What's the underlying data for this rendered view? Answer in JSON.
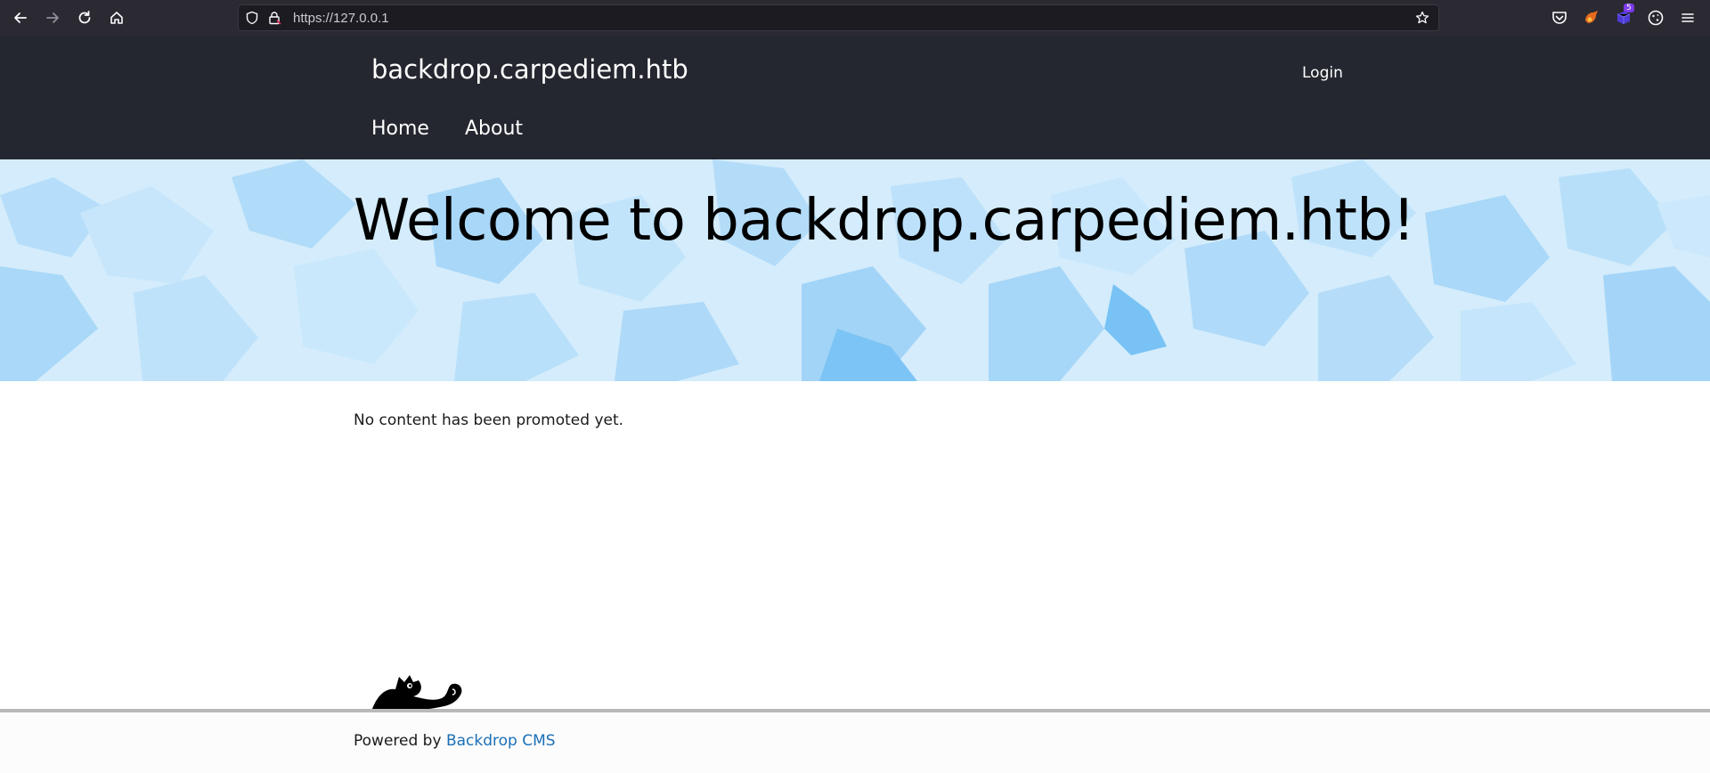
{
  "browser": {
    "url": "https://127.0.0.1",
    "extension_badge": "5"
  },
  "site": {
    "name": "backdrop.carpediem.htb",
    "login_label": "Login",
    "menu": [
      {
        "label": "Home"
      },
      {
        "label": "About"
      }
    ]
  },
  "hero": {
    "title": "Welcome to backdrop.carpediem.htb!"
  },
  "content": {
    "message": "No content has been promoted yet."
  },
  "footer": {
    "powered_by": "Powered by",
    "link_label": "Backdrop CMS"
  },
  "colors": {
    "header_bg": "#24272f",
    "hero_bg": "#d4ecfb",
    "link": "#1a6fb7"
  }
}
